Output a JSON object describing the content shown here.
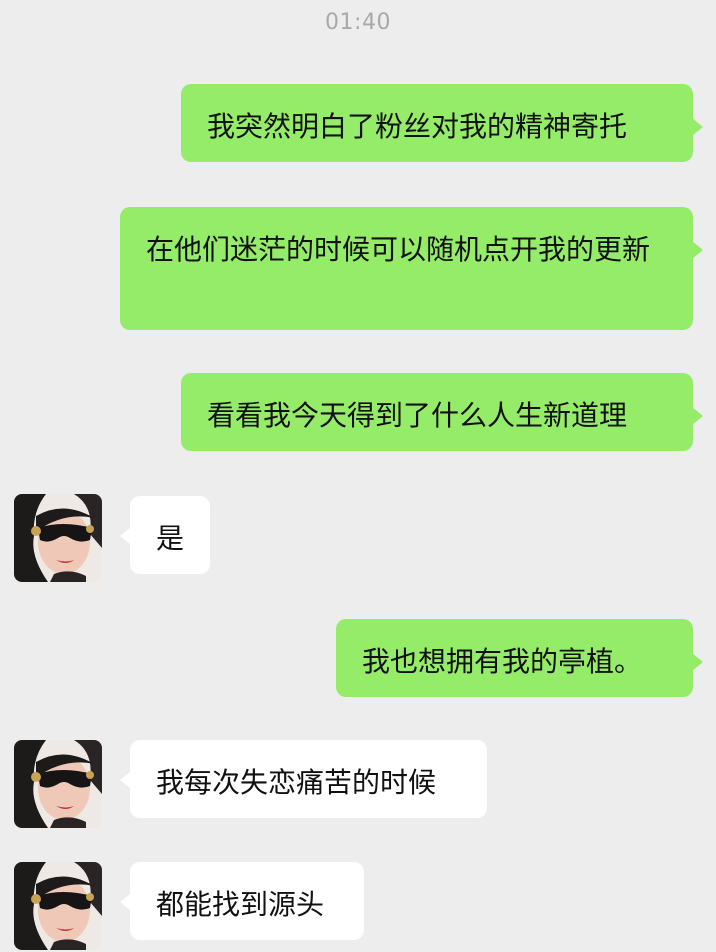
{
  "chat": {
    "timestamp": "01:40",
    "messages": [
      {
        "side": "out",
        "text": "我突然明白了粉丝对我的精神寄托"
      },
      {
        "side": "out",
        "text": "在他们迷茫的时候可以随机点开我的更新"
      },
      {
        "side": "out",
        "text": "看看我今天得到了什么人生新道理"
      },
      {
        "side": "in",
        "text": "是"
      },
      {
        "side": "out",
        "text": "我也想拥有我的亭植。"
      },
      {
        "side": "in",
        "text": "我每次失恋痛苦的时候"
      },
      {
        "side": "in",
        "text": "都能找到源头"
      }
    ]
  },
  "colors": {
    "background": "#ededed",
    "outgoing_bubble": "#95ec69",
    "incoming_bubble": "#ffffff",
    "timestamp_text": "#a9a9a9"
  },
  "icons": {
    "contact_avatar": "avatar-woman-sunglasses"
  }
}
